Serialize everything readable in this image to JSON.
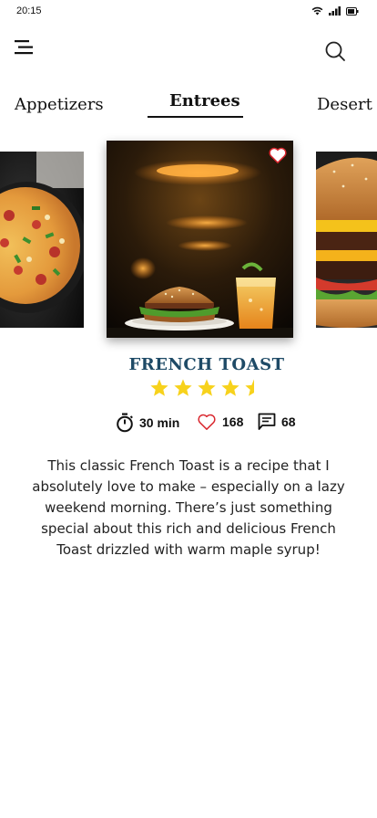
{
  "status": {
    "time": "20:15"
  },
  "header": {
    "menu_icon": "hamburger-menu-icon",
    "search_icon": "search-icon"
  },
  "tabs": [
    {
      "label": "Appetizers",
      "active": false
    },
    {
      "label": "Entrees",
      "active": true
    },
    {
      "label": "Desert",
      "active": false
    }
  ],
  "carousel": [
    {
      "image": "pizza-photo",
      "position": "previous"
    },
    {
      "image": "burger-and-drink-photo",
      "position": "current",
      "favorited": true
    },
    {
      "image": "cheeseburger-photo",
      "position": "next"
    }
  ],
  "recipe": {
    "title": "FRENCH TOAST",
    "rating": 4.5,
    "rating_max": 5,
    "time": "30 min",
    "likes": "168",
    "comments": "68",
    "description": "This classic French Toast is a recipe that I absolutely love to make – especially on a lazy weekend morning. There’s just something special about this rich and delicious French Toast drizzled with warm maple syrup!"
  },
  "colors": {
    "title": "#1e4a66",
    "star": "#f7d21c",
    "heart_outline": "#d9272e"
  }
}
